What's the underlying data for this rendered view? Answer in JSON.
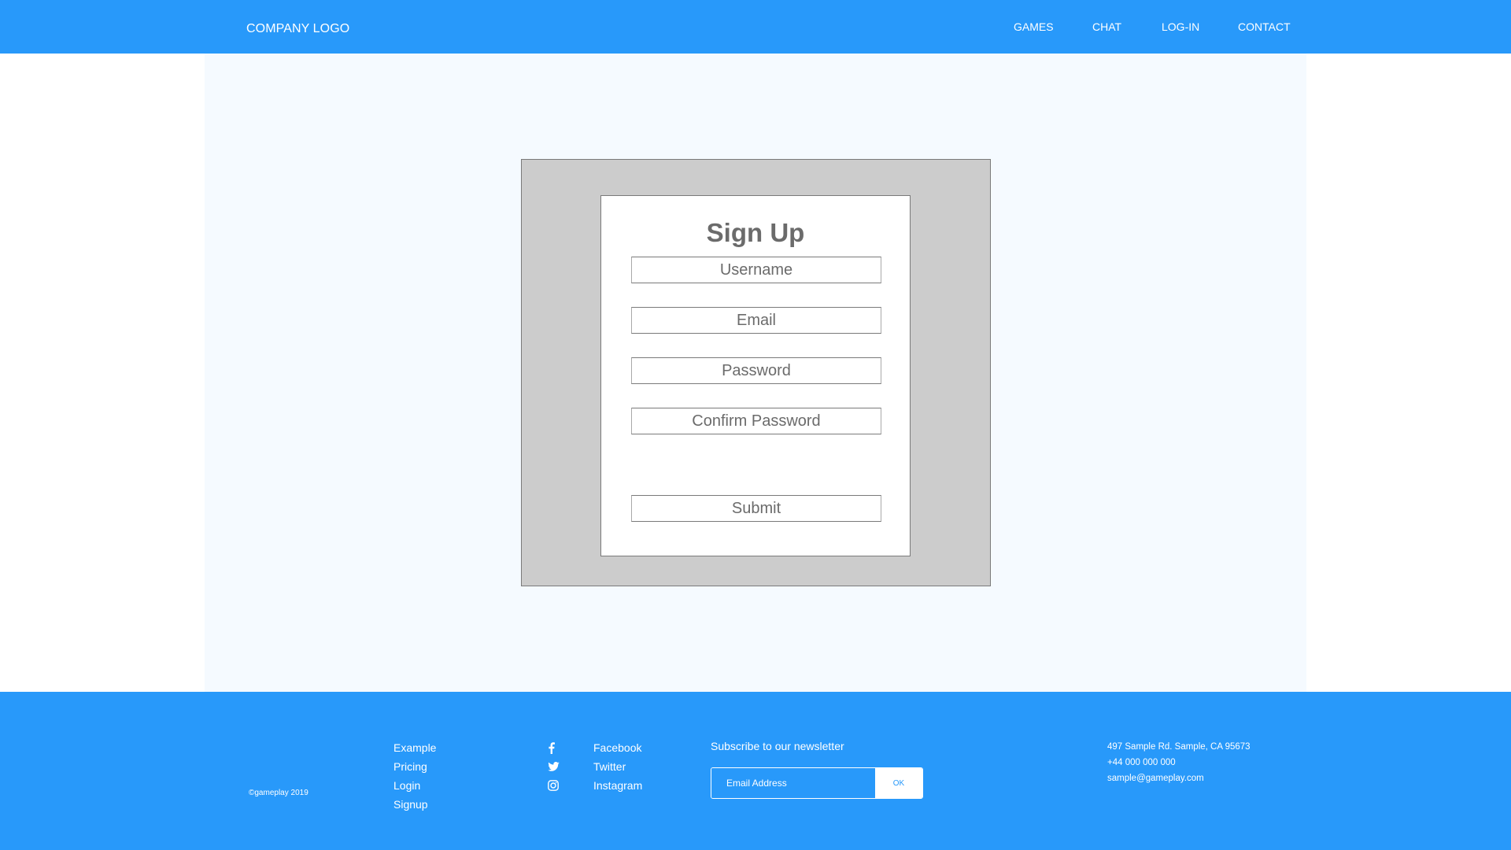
{
  "header": {
    "logo": "COMPANY LOGO",
    "nav": [
      {
        "label": "GAMES"
      },
      {
        "label": "CHAT"
      },
      {
        "label": "LOG-IN"
      },
      {
        "label": "CONTACT"
      }
    ]
  },
  "signup": {
    "title": "Sign Up",
    "fields": [
      {
        "placeholder": "Username",
        "value": ""
      },
      {
        "placeholder": "Email",
        "value": ""
      },
      {
        "placeholder": "Password",
        "value": ""
      },
      {
        "placeholder": "Confirm Password",
        "value": ""
      }
    ],
    "submit_label": "Submit"
  },
  "footer": {
    "copyright": "©gameplay 2019",
    "links": [
      {
        "label": "Example"
      },
      {
        "label": "Pricing"
      },
      {
        "label": "Login"
      },
      {
        "label": "Signup"
      }
    ],
    "social": [
      {
        "label": "Facebook",
        "icon": "facebook-icon"
      },
      {
        "label": "Twitter",
        "icon": "twitter-icon"
      },
      {
        "label": "Instagram",
        "icon": "instagram-icon"
      }
    ],
    "newsletter": {
      "title": "Subscribe to our newsletter",
      "email_placeholder": "Email Address",
      "email_value": "",
      "ok_label": "OK"
    },
    "contact": {
      "address": "497 Sample Rd. Sample, CA 95673",
      "phone": "+44 000 000 000",
      "email": "sample@gameplay.com"
    }
  },
  "colors": {
    "brand_blue": "#2899fa",
    "content_bg": "#f5faff",
    "form_frame_gray": "#cccccc",
    "text_gray": "#6b6b6b"
  }
}
